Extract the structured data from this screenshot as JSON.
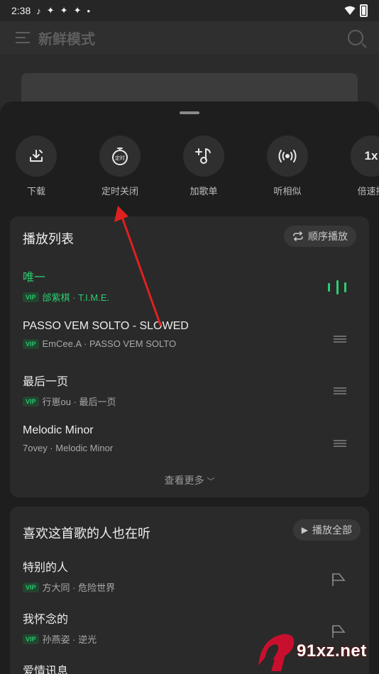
{
  "status_bar": {
    "time": "2:38"
  },
  "background": {
    "title": "新鲜模式"
  },
  "actions": [
    {
      "label": "下载",
      "icon": "download-icon"
    },
    {
      "label": "定时关闭",
      "icon": "timer-icon",
      "icon_text": "定时"
    },
    {
      "label": "加歌单",
      "icon": "add-to-playlist-icon"
    },
    {
      "label": "听相似",
      "icon": "similar-radio-icon"
    },
    {
      "label": "倍速播",
      "icon": "speed-icon",
      "icon_text": "1x"
    }
  ],
  "playlist": {
    "title": "播放列表",
    "mode_label": "顺序播放",
    "songs": [
      {
        "title": "唯一",
        "meta": "邰紫棋 · T.I.M.E.",
        "vip": "VIP",
        "active": true
      },
      {
        "title": "PASSO VEM SOLTO - SLOWED",
        "meta": "EmCee.A · PASSO VEM SOLTO",
        "vip": "VIP"
      },
      {
        "title": "最后一页",
        "meta": "行崽ou · 最后一页",
        "vip": "VIP"
      },
      {
        "title": "Melodic Minor",
        "meta": "7ovey · Melodic Minor"
      }
    ],
    "see_more": "查看更多"
  },
  "similar": {
    "title": "喜欢这首歌的人也在听",
    "play_all_label": "播放全部",
    "songs": [
      {
        "title": "特别的人",
        "meta": "方大同 · 危险世界",
        "vip": "VIP"
      },
      {
        "title": "我怀念的",
        "meta": "孙燕姿 · 逆光",
        "vip": "VIP"
      },
      {
        "title": "爱情讯息"
      }
    ]
  },
  "watermark": {
    "text": "91xz.net",
    "logo_text": "9"
  },
  "colors": {
    "accent": "#2ecc71",
    "annotation": "#e02020",
    "sheet_bg": "#1e1e1e",
    "card_bg": "#2a2a2a"
  }
}
